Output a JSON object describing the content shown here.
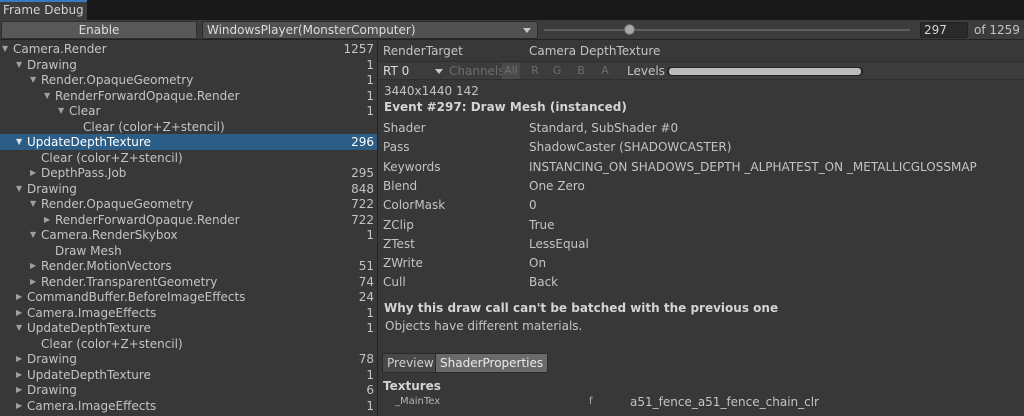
{
  "window": {
    "tab_title": "Frame Debug"
  },
  "toolbar": {
    "enable_label": "Enable",
    "player": "WindowsPlayer(MonsterComputer)",
    "event_index": "297",
    "event_total": "of 1259",
    "slider_fraction": 0.236
  },
  "tree": [
    {
      "label": "Camera.Render",
      "count": "1257",
      "depth": 0,
      "expand": "open"
    },
    {
      "label": "Drawing",
      "count": "1",
      "depth": 1,
      "expand": "open"
    },
    {
      "label": "Render.OpaqueGeometry",
      "count": "1",
      "depth": 2,
      "expand": "open"
    },
    {
      "label": "RenderForwardOpaque.Render",
      "count": "1",
      "depth": 3,
      "expand": "open"
    },
    {
      "label": "Clear",
      "count": "1",
      "depth": 4,
      "expand": "open"
    },
    {
      "label": "Clear (color+Z+stencil)",
      "count": "",
      "depth": 5,
      "expand": "none"
    },
    {
      "label": "UpdateDepthTexture",
      "count": "296",
      "depth": 1,
      "expand": "open",
      "selected": true
    },
    {
      "label": "Clear (color+Z+stencil)",
      "count": "",
      "depth": 2,
      "expand": "none"
    },
    {
      "label": "DepthPass.Job",
      "count": "295",
      "depth": 2,
      "expand": "closed"
    },
    {
      "label": "Drawing",
      "count": "848",
      "depth": 1,
      "expand": "open"
    },
    {
      "label": "Render.OpaqueGeometry",
      "count": "722",
      "depth": 2,
      "expand": "open"
    },
    {
      "label": "RenderForwardOpaque.Render",
      "count": "722",
      "depth": 3,
      "expand": "closed"
    },
    {
      "label": "Camera.RenderSkybox",
      "count": "1",
      "depth": 2,
      "expand": "open"
    },
    {
      "label": "Draw Mesh",
      "count": "",
      "depth": 3,
      "expand": "none"
    },
    {
      "label": "Render.MotionVectors",
      "count": "51",
      "depth": 2,
      "expand": "closed"
    },
    {
      "label": "Render.TransparentGeometry",
      "count": "74",
      "depth": 2,
      "expand": "closed"
    },
    {
      "label": "CommandBuffer.BeforeImageEffects",
      "count": "24",
      "depth": 1,
      "expand": "closed"
    },
    {
      "label": "Camera.ImageEffects",
      "count": "1",
      "depth": 1,
      "expand": "closed"
    },
    {
      "label": "UpdateDepthTexture",
      "count": "1",
      "depth": 1,
      "expand": "open"
    },
    {
      "label": "Clear (color+Z+stencil)",
      "count": "",
      "depth": 2,
      "expand": "none"
    },
    {
      "label": "Drawing",
      "count": "78",
      "depth": 1,
      "expand": "closed"
    },
    {
      "label": "UpdateDepthTexture",
      "count": "1",
      "depth": 1,
      "expand": "closed"
    },
    {
      "label": "Drawing",
      "count": "6",
      "depth": 1,
      "expand": "closed"
    },
    {
      "label": "Camera.ImageEffects",
      "count": "1",
      "depth": 1,
      "expand": "closed"
    }
  ],
  "detail": {
    "render_target_label": "RenderTarget",
    "render_target_value": "Camera DepthTexture",
    "rt_dropdown": "RT 0",
    "channels_label": "Channels",
    "channel_buttons": [
      "All",
      "R",
      "G",
      "B",
      "A"
    ],
    "levels_label": "Levels",
    "levels_fraction": 1.0,
    "resolution": "3440x1440 142",
    "event_title": "Event #297: Draw Mesh (instanced)",
    "properties": [
      {
        "key": "Shader",
        "value": "Standard, SubShader #0"
      },
      {
        "key": "Pass",
        "value": "ShadowCaster (SHADOWCASTER)"
      },
      {
        "key": "Keywords",
        "value": "INSTANCING_ON SHADOWS_DEPTH _ALPHATEST_ON _METALLICGLOSSMAP"
      },
      {
        "key": "Blend",
        "value": "One Zero"
      },
      {
        "key": "ColorMask",
        "value": "0"
      },
      {
        "key": "ZClip",
        "value": "True"
      },
      {
        "key": "ZTest",
        "value": "LessEqual"
      },
      {
        "key": "ZWrite",
        "value": "On"
      },
      {
        "key": "Cull",
        "value": "Back"
      }
    ],
    "batch_heading": "Why this draw call can't be batched with the previous one",
    "batch_reason": "Objects have different materials.",
    "tabs": {
      "preview": "Preview",
      "shader_properties": "ShaderProperties"
    },
    "textures_heading": "Textures",
    "texture_row": {
      "name": "_MainTex",
      "flag": "f",
      "value": "a51_fence_a51_fence_chain_clr"
    }
  }
}
